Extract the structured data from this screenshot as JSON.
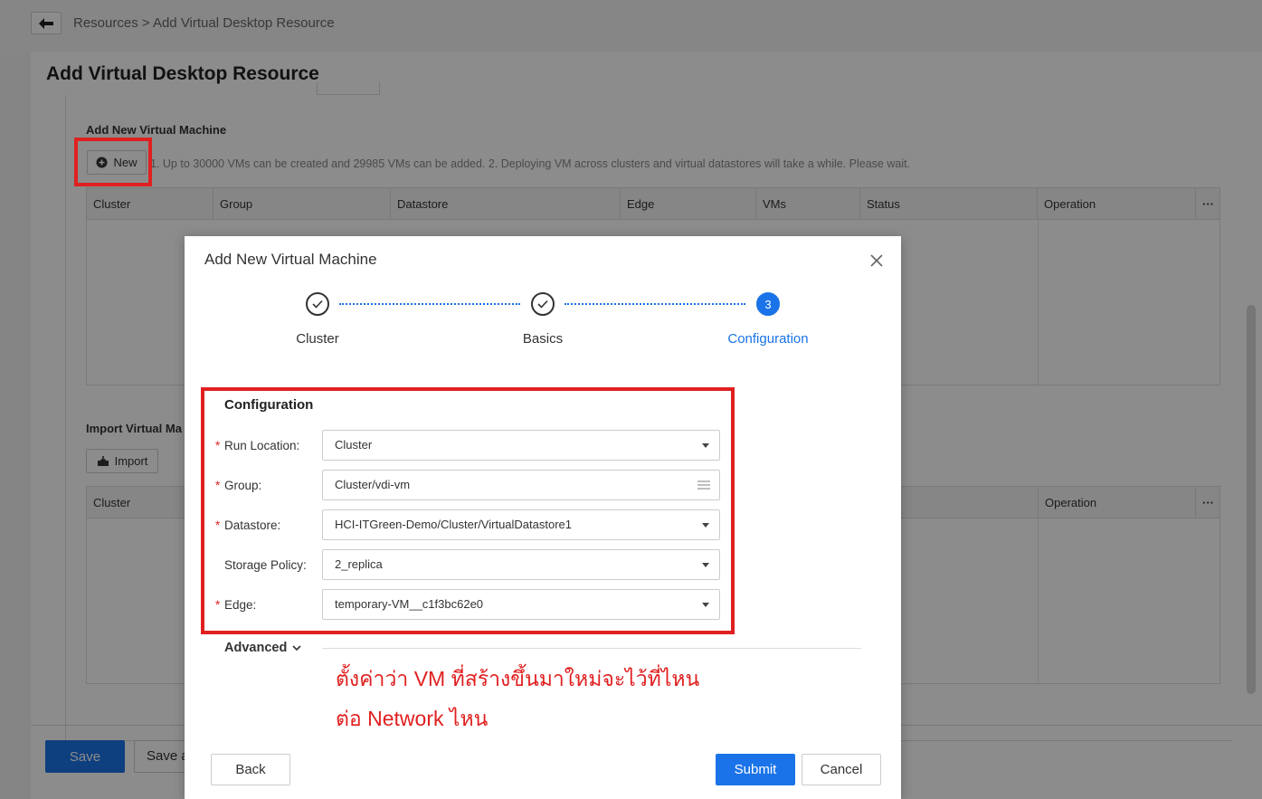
{
  "breadcrumb": "Resources > Add Virtual Desktop Resource",
  "page": {
    "title": "Add Virtual Desktop Resource",
    "add_vm_section": "Add New Virtual Machine",
    "new_button": "New",
    "hint": "1. Up to 30000 VMs can be created and 29985 VMs can be added. 2. Deploying VM across clusters and virtual datastores will take a while. Please wait.",
    "columns": [
      "Cluster",
      "Group",
      "Datastore",
      "Edge",
      "VMs",
      "Status",
      "Operation",
      "···"
    ],
    "import_section": "Import Virtual Ma",
    "import_button": "Import",
    "import_columns": [
      "Cluster",
      "Operation",
      "···"
    ],
    "save_button": "Save",
    "save_as_button": "Save a"
  },
  "modal": {
    "title": "Add New Virtual Machine",
    "steps": [
      {
        "label": "Cluster",
        "state": "done"
      },
      {
        "label": "Basics",
        "state": "done"
      },
      {
        "label": "Configuration",
        "state": "active",
        "number": "3"
      }
    ],
    "section_title": "Configuration",
    "fields": [
      {
        "label": "Run Location:",
        "required": true,
        "value": "Cluster",
        "kind": "select"
      },
      {
        "label": "Group:",
        "required": true,
        "value": "Cluster/vdi-vm",
        "kind": "list"
      },
      {
        "label": "Datastore:",
        "required": true,
        "value": "HCI-ITGreen-Demo/Cluster/VirtualDatastore1",
        "kind": "select"
      },
      {
        "label": "Storage Policy:",
        "required": false,
        "value": "2_replica",
        "kind": "select"
      },
      {
        "label": "Edge:",
        "required": true,
        "value": "temporary-VM__c1f3bc62e0",
        "kind": "select"
      }
    ],
    "advanced": "Advanced",
    "annotation_line1": "ตั้งค่าว่า VM ที่สร้างขึ้นมาใหม่จะไว้ที่ไหน",
    "annotation_line2": "ต่อ Network ไหน",
    "back_button": "Back",
    "submit_button": "Submit",
    "cancel_button": "Cancel"
  },
  "colors": {
    "accent": "#1a73e8",
    "highlight": "#e02020"
  }
}
